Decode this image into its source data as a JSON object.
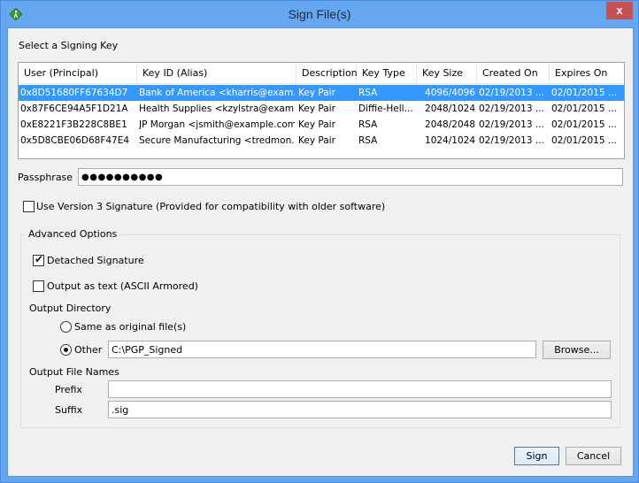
{
  "window": {
    "title": "Sign File(s)",
    "close_label": "x"
  },
  "key_section": {
    "label": "Select a Signing Key",
    "columns": [
      "User (Principal)",
      "Key ID (Alias)",
      "Description",
      "Key Type",
      "Key Size",
      "Created On",
      "Expires On"
    ],
    "rows": [
      {
        "user": "0x8D51680FF67634D7",
        "key_id": "Bank of America <kharris@exam...",
        "description": "Key Pair",
        "key_type": "RSA",
        "key_size": "4096/4096",
        "created": "02/19/2013 ...",
        "expires": "02/01/2015 ...",
        "selected": true
      },
      {
        "user": "0x87F6CE94A5F1D21A",
        "key_id": "Health Supplies <kzylstra@exam...",
        "description": "Key Pair",
        "key_type": "Diffie-Hell...",
        "key_size": "2048/1024",
        "created": "02/19/2013 ...",
        "expires": "02/01/2015 ...",
        "selected": false
      },
      {
        "user": "0xE8221F3B228C8BE1",
        "key_id": "JP Morgan <jsmith@example.com>",
        "description": "Key Pair",
        "key_type": "RSA",
        "key_size": "2048/2048",
        "created": "02/19/2013 ...",
        "expires": "02/01/2015 ...",
        "selected": false
      },
      {
        "user": "0x5D8CBE06D68F47E4",
        "key_id": "Secure Manufacturing <tredmon...",
        "description": "Key Pair",
        "key_type": "RSA",
        "key_size": "1024/1024",
        "created": "02/19/2013 ...",
        "expires": "02/01/2015 ...",
        "selected": false
      }
    ]
  },
  "passphrase": {
    "label": "Passphrase",
    "value": "●●●●●●●●●●"
  },
  "version3": {
    "label": "Use Version 3 Signature (Provided for compatibility with older software)",
    "checked": false
  },
  "advanced": {
    "legend": "Advanced Options",
    "detached": {
      "label": "Detached Signature",
      "checked": true
    },
    "ascii": {
      "label": "Output as text (ASCII Armored)",
      "checked": false
    },
    "output_dir_label": "Output Directory",
    "same_as_original": {
      "label": "Same as original file(s)",
      "selected": false
    },
    "other": {
      "label": "Other",
      "selected": true,
      "value": "C:\\PGP_Signed"
    },
    "browse_label": "Browse...",
    "file_names_label": "Output File Names",
    "prefix": {
      "label": "Prefix",
      "value": ""
    },
    "suffix": {
      "label": "Suffix",
      "value": ".sig"
    }
  },
  "footer": {
    "sign_label": "Sign",
    "cancel_label": "Cancel"
  }
}
